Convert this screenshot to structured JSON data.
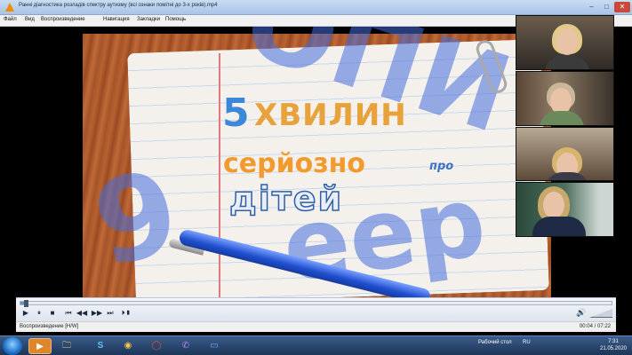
{
  "window": {
    "title": "Ранні діагностика розладів спектру аутизму (всі ознаки помітні до 3-х років).mp4",
    "minimize": "–",
    "maximize": "□",
    "close": "✕"
  },
  "menu": [
    "Файл",
    "Вид",
    "Воспроизведение",
    "Навигация",
    "Закладки",
    "Помощь"
  ],
  "video": {
    "title_number": "5",
    "title_word1": "ХВИЛИН",
    "title_word2": "серйозно",
    "title_word3": "про",
    "title_word4": "дітей"
  },
  "controls": {
    "progress_fraction": 0.009,
    "buttons": [
      "▶",
      "⏸",
      "■",
      "⏮",
      "◀◀",
      "▶▶",
      "⏭",
      "⏵▮"
    ],
    "volume_icon": "🔊"
  },
  "status": {
    "text": "Воспроизведение [H/W]",
    "time": "00:04 / 07:22"
  },
  "taskbar": {
    "apps": [
      "▶",
      "🗀",
      "S",
      "◉",
      "◯",
      "✆",
      "▭"
    ],
    "desktop_label": "Рабочий стол",
    "language": "RU",
    "clock_time": "7:31",
    "clock_date": "21.05.2020"
  },
  "colors": {
    "accent": "#3d87d8",
    "title_orange": "#e8a23b",
    "taskbar": "#1d3557"
  }
}
